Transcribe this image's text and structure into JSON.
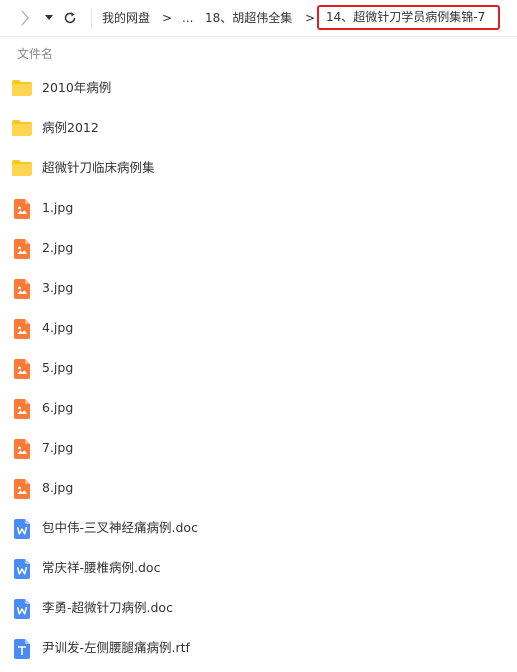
{
  "toolbar": {
    "icons": [
      "chevron-right-icon",
      "caret-down-icon",
      "refresh-icon"
    ]
  },
  "breadcrumb": {
    "root": "我的网盘",
    "ellipsis": "...",
    "parent": "18、胡超伟全集",
    "current": "14、超微针刀学员病例集锦-7",
    "separator": ">"
  },
  "list_header": {
    "name_column": "文件名"
  },
  "files": [
    {
      "name": "2010年病例",
      "type": "folder"
    },
    {
      "name": "病例2012",
      "type": "folder"
    },
    {
      "name": "超微针刀临床病例集",
      "type": "folder"
    },
    {
      "name": "1.jpg",
      "type": "image"
    },
    {
      "name": "2.jpg",
      "type": "image"
    },
    {
      "name": "3.jpg",
      "type": "image"
    },
    {
      "name": "4.jpg",
      "type": "image"
    },
    {
      "name": "5.jpg",
      "type": "image"
    },
    {
      "name": "6.jpg",
      "type": "image"
    },
    {
      "name": "7.jpg",
      "type": "image"
    },
    {
      "name": "8.jpg",
      "type": "image"
    },
    {
      "name": "包中伟-三叉神经痛病例.doc",
      "type": "doc"
    },
    {
      "name": "常庆祥-腰椎病例.doc",
      "type": "doc"
    },
    {
      "name": "李勇-超微针刀病例.doc",
      "type": "doc"
    },
    {
      "name": "尹训发-左侧腰腿痛病例.rtf",
      "type": "rtf"
    }
  ],
  "colors": {
    "folder": "#ffd54f",
    "folder_tab": "#ffc629",
    "image": "#ff7a36",
    "doc": "#4a8cf7",
    "highlight_border": "#e02020"
  }
}
